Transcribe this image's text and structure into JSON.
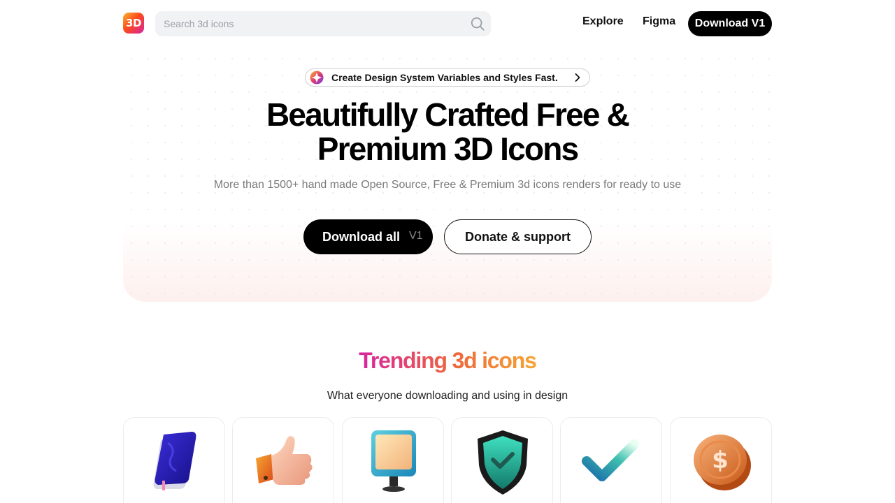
{
  "header": {
    "logo_text": "3D",
    "search_placeholder": "Search 3d icons",
    "nav": [
      {
        "label": "Explore"
      },
      {
        "label": "Figma"
      }
    ],
    "download_label": "Download V1"
  },
  "hero": {
    "announcement": "Create Design System Variables and Styles Fast.",
    "title_line1": "Beautifully Crafted Free &",
    "title_line2": "Premium 3D Icons",
    "subtitle": "More than 1500+ hand made Open Source, Free & Premium 3d icons renders for ready to use",
    "primary_button": {
      "label": "Download all",
      "version": "V1"
    },
    "secondary_button": {
      "label": "Donate & support"
    }
  },
  "trending": {
    "title": "Trending 3d icons",
    "subtitle": "What everyone downloading and using in design",
    "icons": [
      {
        "icon": "notebook-icon"
      },
      {
        "icon": "thumbs-up-icon"
      },
      {
        "icon": "monitor-icon"
      },
      {
        "icon": "shield-check-icon"
      },
      {
        "icon": "checkmark-icon"
      },
      {
        "icon": "dollar-coin-icon"
      }
    ]
  },
  "colors": {
    "brand_gradient": [
      "#d6249f",
      "#f0683a",
      "#f7a531"
    ],
    "primary_button": "#000000",
    "search_background": "#f1f2f4"
  }
}
